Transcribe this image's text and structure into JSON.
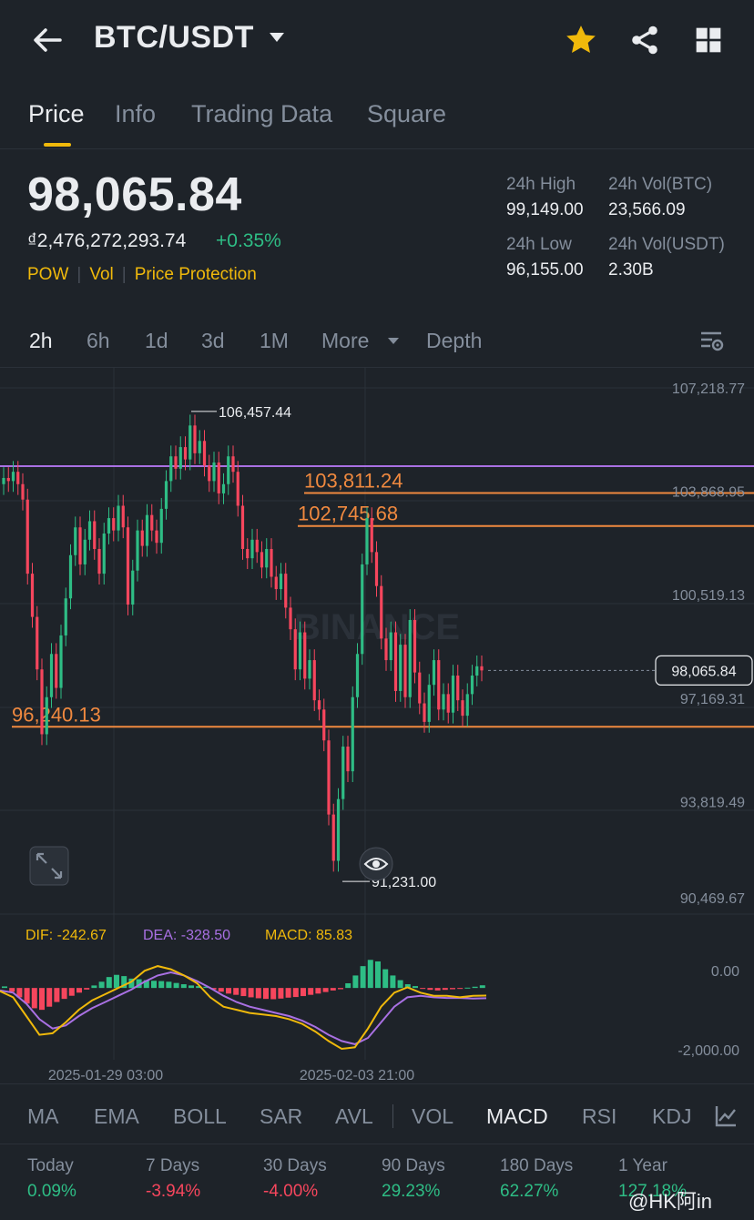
{
  "header": {
    "pair": "BTC/USDT",
    "icons": [
      "back-arrow-icon",
      "chevron-down-icon",
      "star-icon",
      "share-icon",
      "grid-icon"
    ],
    "star_color": "#f0b90b"
  },
  "tabs": [
    {
      "label": "Price",
      "active": true
    },
    {
      "label": "Info"
    },
    {
      "label": "Trading Data"
    },
    {
      "label": "Square"
    }
  ],
  "ticker": {
    "price": "98,065.84",
    "fiat_value": "₫2,476,272,293.74",
    "change": "+0.35%",
    "tags": [
      "POW",
      "Vol",
      "Price Protection"
    ],
    "stats": [
      {
        "label": "24h High",
        "value": "99,149.00"
      },
      {
        "label": "24h Vol(BTC)",
        "value": "23,566.09"
      },
      {
        "label": "24h Low",
        "value": "96,155.00"
      },
      {
        "label": "24h Vol(USDT)",
        "value": "2.30B"
      }
    ]
  },
  "timeframes": [
    "2h",
    "6h",
    "1d",
    "3d",
    "1M",
    "More",
    "Depth"
  ],
  "active_timeframe": "2h",
  "chart": {
    "price_axis": [
      "107,218.77",
      "103,868.95",
      "100,519.13",
      "97,169.31",
      "93,819.49",
      "90,469.67"
    ],
    "macd_axis": [
      "0.00",
      "-2,000.00"
    ],
    "time_axis": [
      "2025-01-29 03:00",
      "2025-02-03 21:00"
    ],
    "levels": [
      "103,811.24",
      "102,745.68",
      "96,240.13"
    ],
    "high_annotation": "106,457.44",
    "low_annotation": "91,231.00",
    "current_price": "98,065.84",
    "watermark": "BINANCE",
    "macd": {
      "dif": "DIF: -242.67",
      "dea": "DEA: -328.50",
      "macd": "MACD: 85.83"
    },
    "colors": {
      "up": "#2ebd85",
      "down": "#f6465d",
      "level": "#f0893f",
      "ma": "#a970e3",
      "dif": "#f0b90b",
      "dea": "#a970e3"
    }
  },
  "chart_data": {
    "type": "candlestick",
    "ylim": [
      90469.67,
      107218.77
    ],
    "levels": [
      103811.24,
      102745.68,
      96240.13
    ],
    "high": 106457.44,
    "low": 91231.0,
    "current": 98065.84,
    "closes": [
      104300,
      104200,
      104500,
      104100,
      103600,
      101200,
      99800,
      98100,
      96000,
      97200,
      98600,
      97500,
      99200,
      100400,
      101800,
      102700,
      101500,
      102300,
      102900,
      102000,
      101200,
      102500,
      103000,
      102600,
      103400,
      102700,
      100200,
      101300,
      102600,
      102100,
      103100,
      102600,
      102200,
      103300,
      104200,
      105000,
      104600,
      105300,
      104900,
      106000,
      105100,
      105500,
      104700,
      104200,
      104800,
      103800,
      104100,
      105000,
      104500,
      103400,
      102000,
      101700,
      102300,
      101900,
      101400,
      102000,
      101100,
      100700,
      101200,
      100100,
      99400,
      98100,
      99300,
      97800,
      98400,
      97100,
      96800,
      95800,
      93400,
      91900,
      93900,
      95600,
      94800,
      97200,
      98600,
      101500,
      103000,
      101900,
      100800,
      99100,
      98400,
      99300,
      97400,
      98900,
      97200,
      99700,
      98000,
      97000,
      96400,
      97600,
      98400,
      96800,
      97300,
      96700,
      97900,
      97100,
      96600,
      97300,
      97900,
      98200,
      98065.84
    ],
    "macd_hist": [
      50,
      -120,
      -300,
      -500,
      -650,
      -700,
      -600,
      -450,
      -350,
      -250,
      -150,
      -50,
      80,
      200,
      350,
      420,
      380,
      300,
      280,
      250,
      230,
      220,
      200,
      160,
      120,
      80,
      60,
      40,
      -50,
      -120,
      -180,
      -220,
      -260,
      -300,
      -330,
      -350,
      -360,
      -340,
      -310,
      -290,
      -260,
      -220,
      -180,
      -130,
      -80,
      -40,
      150,
      400,
      700,
      900,
      850,
      600,
      400,
      250,
      120,
      60,
      -20,
      -60,
      -80,
      -60,
      -40,
      -20,
      10,
      40,
      85.83
    ],
    "dif": [
      -100,
      -300,
      -900,
      -1500,
      -1450,
      -1100,
      -700,
      -400,
      -200,
      0,
      200,
      550,
      700,
      600,
      400,
      150,
      -300,
      -600,
      -700,
      -800,
      -850,
      -900,
      -1000,
      -1150,
      -1400,
      -1700,
      -1950,
      -1900,
      -1300,
      -600,
      -150,
      20,
      -150,
      -250,
      -250,
      -300,
      -250,
      -242.67
    ],
    "dea": [
      -80,
      -150,
      -500,
      -1000,
      -1300,
      -1200,
      -900,
      -650,
      -450,
      -250,
      -50,
      200,
      400,
      500,
      400,
      220,
      0,
      -250,
      -450,
      -600,
      -700,
      -800,
      -900,
      -1050,
      -1250,
      -1500,
      -1700,
      -1800,
      -1600,
      -1100,
      -600,
      -300,
      -250,
      -300,
      -320,
      -320,
      -340,
      -328.5
    ]
  },
  "indicators": [
    "MA",
    "EMA",
    "BOLL",
    "SAR",
    "AVL",
    "VOL",
    "MACD",
    "RSI",
    "KDJ"
  ],
  "active_indicator": "MACD",
  "performance": [
    {
      "label": "Today",
      "value": "0.09%",
      "dir": "pos"
    },
    {
      "label": "7 Days",
      "value": "-3.94%",
      "dir": "neg"
    },
    {
      "label": "30 Days",
      "value": "-4.00%",
      "dir": "neg"
    },
    {
      "label": "90 Days",
      "value": "29.23%",
      "dir": "pos"
    },
    {
      "label": "180 Days",
      "value": "62.27%",
      "dir": "pos"
    },
    {
      "label": "1 Year",
      "value": "127.18%",
      "dir": "pos"
    }
  ],
  "watermark_user": "@HK阿in"
}
